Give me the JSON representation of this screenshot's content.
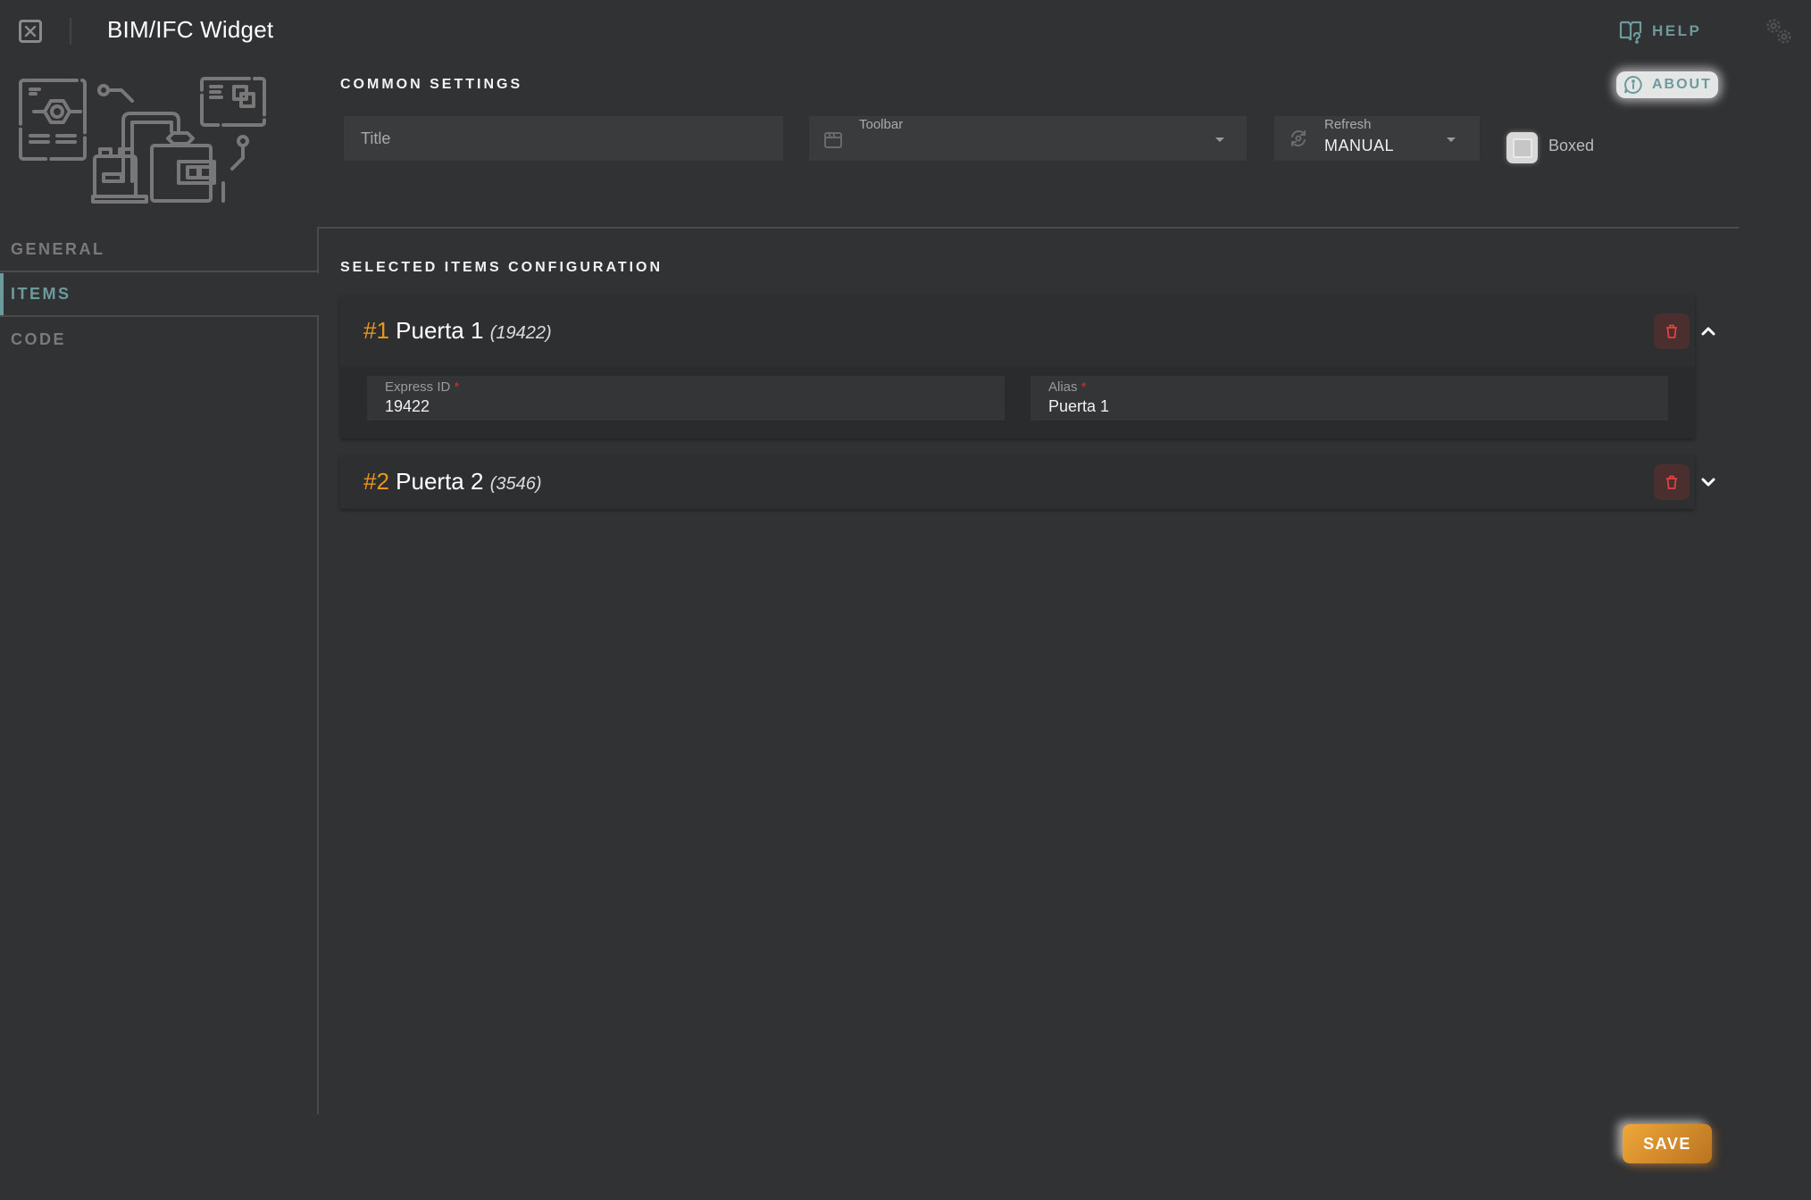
{
  "header": {
    "title": "BIM/IFC Widget",
    "close_icon": "close-icon",
    "help_label": "HELP",
    "help_icon": "book-question-icon",
    "settings_icon": "gears-icon"
  },
  "about": {
    "label": "ABOUT",
    "icon": "info-chat-icon"
  },
  "sidebar": {
    "illustration": "industrial-automation-illustration",
    "tabs": [
      {
        "label": "GENERAL",
        "active": false
      },
      {
        "label": "ITEMS",
        "active": true
      },
      {
        "label": "CODE",
        "active": false
      }
    ]
  },
  "common_settings": {
    "title": "COMMON SETTINGS",
    "title_field": {
      "placeholder": "Title",
      "value": ""
    },
    "toolbar_field": {
      "label": "Toolbar",
      "value": "",
      "icon": "clapperboard-icon"
    },
    "refresh_field": {
      "label": "Refresh",
      "value": "MANUAL",
      "icon": "refresh-icon"
    },
    "boxed": {
      "label": "Boxed",
      "checked": false
    }
  },
  "items_config": {
    "title": "SELECTED ITEMS CONFIGURATION",
    "items": [
      {
        "number": "#1",
        "name": "Puerta 1",
        "id_display": "(19422)",
        "expanded": true,
        "express_id_label": "Express ID",
        "express_id": "19422",
        "alias_label": "Alias",
        "alias": "Puerta 1",
        "required_mark": "*"
      },
      {
        "number": "#2",
        "name": "Puerta 2",
        "id_display": "(3546)",
        "expanded": false
      }
    ]
  },
  "footer": {
    "save_label": "SAVE"
  },
  "colors": {
    "background": "#313234",
    "accent_teal": "#6d9a9c",
    "accent_orange": "#e8961e",
    "danger": "#e04040"
  }
}
